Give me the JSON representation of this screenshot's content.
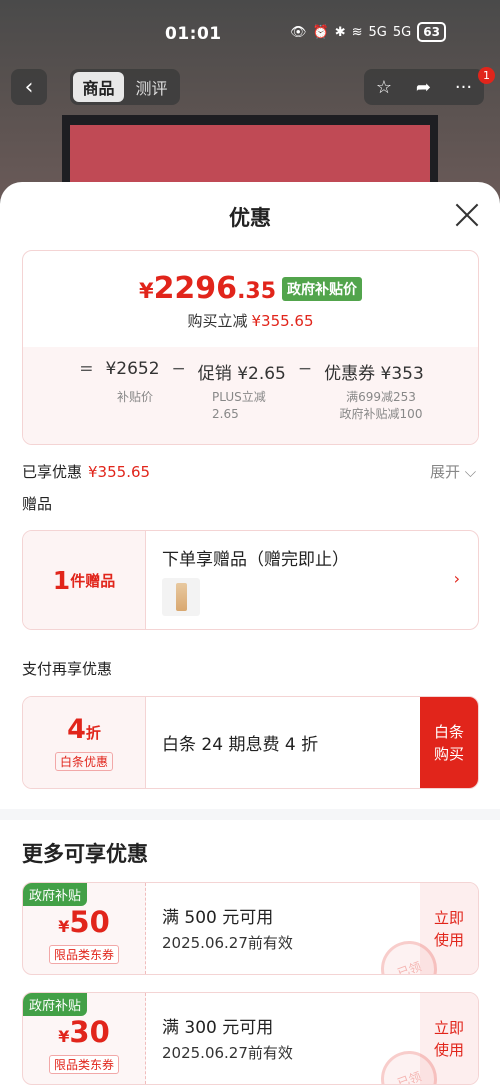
{
  "status_bar": {
    "time": "01:01",
    "signal1": "5G",
    "signal2": "5G",
    "battery": "63"
  },
  "header": {
    "tabs": [
      {
        "label": "商品"
      },
      {
        "label": "测评"
      }
    ],
    "notification_count": "1"
  },
  "sheet": {
    "title": "优惠",
    "price": {
      "currency": "¥",
      "integer": "2296",
      "decimal": ".35",
      "tag": "政府补贴价",
      "reduce_label": "购买立减",
      "reduce_value": "¥355.65"
    },
    "formula": {
      "eq": "=",
      "base": "¥2652",
      "minus1": "−",
      "promo": "促销 ¥2.65",
      "minus2": "−",
      "coupon": "优惠券 ¥353",
      "base_label": "补贴价",
      "promo_label_1": "PLUS立减",
      "promo_label_2": "2.65",
      "coupon_label_1": "满699减253",
      "coupon_label_2": "政府补贴减100"
    },
    "enjoyed": {
      "label": "已享优惠",
      "value": "¥355.65",
      "expand": "展开 ⌵"
    },
    "gift_section_label": "赠品",
    "gift": {
      "count": "1",
      "count_suffix": "件赠品",
      "title": "下单享赠品（赠完即止）"
    },
    "pay_section_label": "支付再享优惠",
    "baitiao": {
      "discount": "4",
      "discount_suffix": "折",
      "tag": "白条优惠",
      "desc": "白条 24 期息费 4 折",
      "button_line1": "白条",
      "button_line2": "购买"
    },
    "more_title": "更多可享优惠",
    "coupons": [
      {
        "badge": "政府补贴",
        "currency": "¥",
        "amount": "50",
        "type": "限品类东券",
        "condition": "满 500 元可用",
        "valid": "2025.06.27前有效",
        "btn1": "立即",
        "btn2": "使用",
        "stamp": "已领"
      },
      {
        "badge": "政府补贴",
        "currency": "¥",
        "amount": "30",
        "type": "限品类东券",
        "condition": "满 300 元可用",
        "valid": "2025.06.27前有效",
        "btn1": "立即",
        "btn2": "使用",
        "stamp": "已领"
      }
    ]
  },
  "colors": {
    "accent": "#e1251b",
    "gov_green": "#52a44c"
  }
}
